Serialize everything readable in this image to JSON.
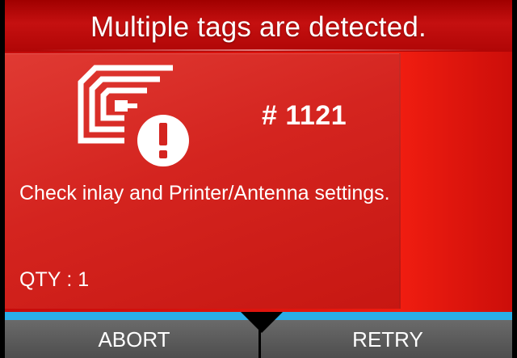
{
  "header": {
    "title": "Multiple tags are detected."
  },
  "error": {
    "icon": "rfid-tag-error-icon",
    "code": "# 1121",
    "message": "Check inlay and Printer/Antenna settings.",
    "qty_label": "QTY",
    "qty_separator": " : ",
    "qty_value": "1"
  },
  "softkeys": {
    "left_label": "ABORT",
    "right_label": "RETRY"
  },
  "colors": {
    "title_bg": "#b00606",
    "body_bg": "#e2160e",
    "panel_bg": "#d4241f",
    "accent_strip": "#2aaee8",
    "softkey_bg": "#5a5a5a",
    "text": "#ffffff"
  }
}
